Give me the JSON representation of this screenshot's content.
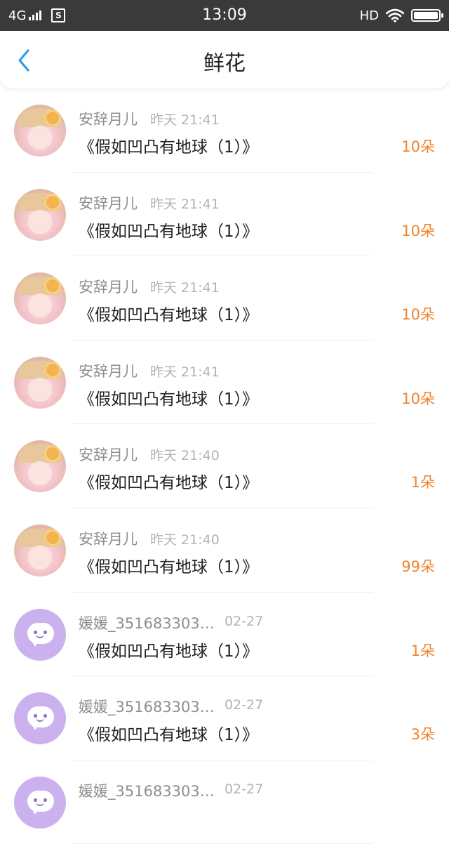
{
  "status_bar": {
    "network": "4G",
    "sim_icon": "S",
    "time": "13:09",
    "hd": "HD",
    "battery_level": 1.0
  },
  "header": {
    "title": "鲜花",
    "back_icon": "chevron-left-icon"
  },
  "colors": {
    "accent_blue": "#2a9ef4",
    "count_orange": "#f0832b",
    "status_bar_bg": "#3a3a3a",
    "avatar_purple": "#cbb1ee"
  },
  "items": [
    {
      "avatar": "photo",
      "name": "安辞月儿",
      "time": "昨天 21:41",
      "title": "《假如凹凸有地球（1）》",
      "count": "10朵"
    },
    {
      "avatar": "photo",
      "name": "安辞月儿",
      "time": "昨天 21:41",
      "title": "《假如凹凸有地球（1）》",
      "count": "10朵"
    },
    {
      "avatar": "photo",
      "name": "安辞月儿",
      "time": "昨天 21:41",
      "title": "《假如凹凸有地球（1）》",
      "count": "10朵"
    },
    {
      "avatar": "photo",
      "name": "安辞月儿",
      "time": "昨天 21:41",
      "title": "《假如凹凸有地球（1）》",
      "count": "10朵"
    },
    {
      "avatar": "photo",
      "name": "安辞月儿",
      "time": "昨天 21:40",
      "title": "《假如凹凸有地球（1）》",
      "count": "1朵"
    },
    {
      "avatar": "photo",
      "name": "安辞月儿",
      "time": "昨天 21:40",
      "title": "《假如凹凸有地球（1）》",
      "count": "99朵"
    },
    {
      "avatar": "chat-bubble",
      "name": "媛媛_351683303…",
      "time": "02-27",
      "title": "《假如凹凸有地球（1）》",
      "count": "1朵"
    },
    {
      "avatar": "chat-bubble",
      "name": "媛媛_351683303…",
      "time": "02-27",
      "title": "《假如凹凸有地球（1）》",
      "count": "3朵"
    },
    {
      "avatar": "chat-bubble",
      "name": "媛媛_351683303…",
      "time": "02-27",
      "title": "",
      "count": ""
    }
  ]
}
